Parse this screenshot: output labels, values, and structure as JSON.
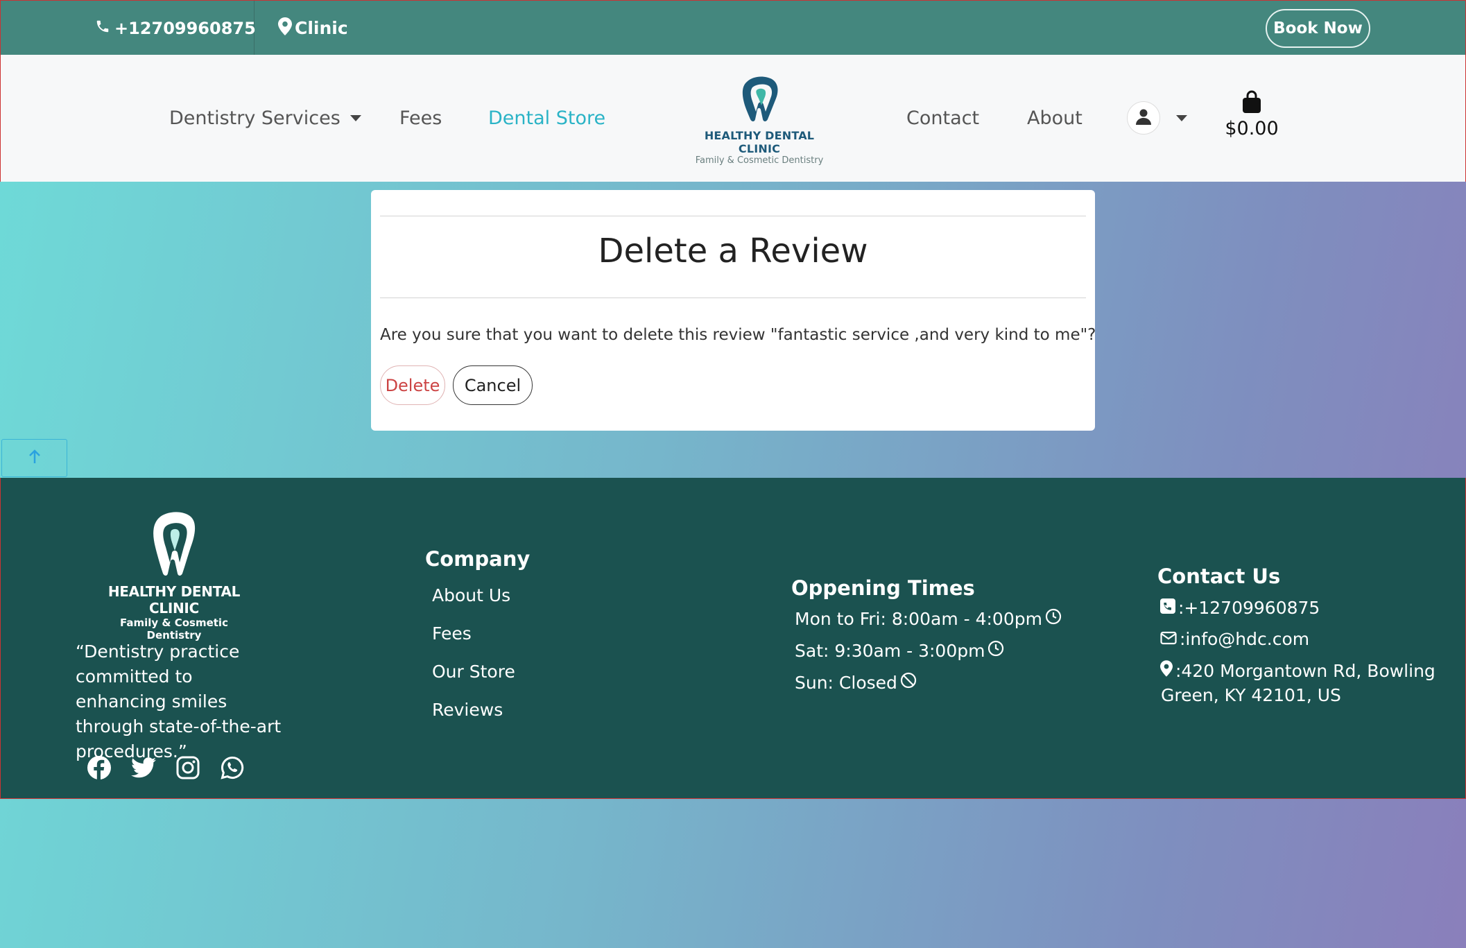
{
  "topbar": {
    "phone": "+12709960875",
    "clinic": "Clinic",
    "book_now": "Book Now"
  },
  "nav": {
    "services": "Dentistry Services",
    "fees": "Fees",
    "store": "Dental Store",
    "contact": "Contact",
    "about": "About",
    "cart_total": "$0.00"
  },
  "brand": {
    "name": "HEALTHY DENTAL CLINIC",
    "tagline": "Family & Cosmetic Dentistry",
    "color_primary": "#44877e",
    "color_accent": "#2ab3c6",
    "color_footer": "#1b5250"
  },
  "dialog": {
    "title": "Delete a Review",
    "question": "Are you sure that you want to delete this review \"fantastic service ,and very kind to me\"?",
    "delete_label": "Delete",
    "cancel_label": "Cancel"
  },
  "footer": {
    "quote": "“Dentistry practice committed to enhancing smiles through state-of-the-art procedures.”",
    "company_heading": "Company",
    "company_links": [
      "About Us",
      "Fees",
      "Our Store",
      "Reviews"
    ],
    "hours_heading": "Oppening Times",
    "hours": [
      "Mon to Fri: 8:00am - 4:00pm",
      "Sat: 9:30am - 3:00pm",
      "Sun: Closed"
    ],
    "contact_heading": "Contact Us",
    "contact_phone": ":+12709960875",
    "contact_email": ":info@hdc.com",
    "contact_address_1": ":420 Morgantown Rd, Bowling",
    "contact_address_2": "Green, KY 42101, US"
  },
  "icons": [
    "phone-icon",
    "map-pin-icon",
    "user-icon",
    "shopping-bag-icon",
    "arrow-up-icon",
    "facebook-icon",
    "twitter-icon",
    "instagram-icon",
    "whatsapp-icon",
    "clock-icon",
    "ban-icon",
    "phone-square-icon",
    "envelope-icon"
  ]
}
